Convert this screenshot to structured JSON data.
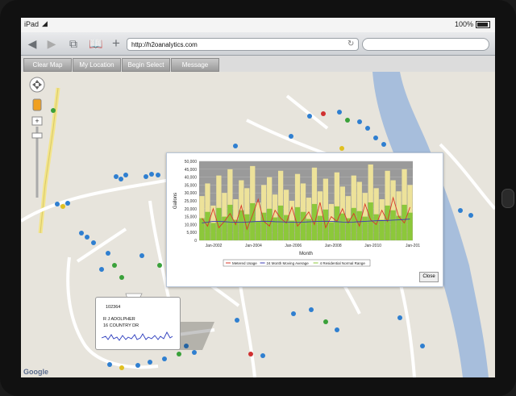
{
  "device": {
    "carrier": "iPad",
    "battery": "100%"
  },
  "browser": {
    "url": "http://h2oanalytics.com"
  },
  "app_buttons": [
    "Clear Map",
    "My Location",
    "Begin Select",
    "Message"
  ],
  "map": {
    "attribution": "Google"
  },
  "info_bubble": {
    "account_id": "102364",
    "owner": "R J ADOLPHER",
    "address": "16  COUNTRY DR"
  },
  "popup": {
    "close_label": "Close"
  },
  "colors": {
    "metered": "#d9372a",
    "moving_avg": "#3b3bb3",
    "normal_range_low": "#8cc83a",
    "normal_range_high": "#ede29a",
    "plot_bg": "#9a9a9a"
  },
  "chart_data": {
    "type": "area",
    "xlabel": "Month",
    "ylabel": "Gallons",
    "ylim": [
      0,
      50000
    ],
    "yticks": [
      "50,000",
      "45,000",
      "40,000",
      "35,000",
      "30,000",
      "25,000",
      "20,000",
      "15,000",
      "10,000",
      "5,000",
      "0"
    ],
    "xticks": [
      "Jan-2002",
      "Jan-2004",
      "Jan-2006",
      "Jan-2008",
      "Jan-2010",
      "Jan-201"
    ],
    "x_range": [
      2001.0,
      2012.1
    ],
    "series": [
      {
        "name": "Metered Usage",
        "values": [
          14000,
          9000,
          20000,
          8000,
          12000,
          17000,
          10000,
          22000,
          7000,
          16000,
          26000,
          12000,
          9000,
          19000,
          14000,
          11000,
          21000,
          9000,
          13000,
          18000,
          10000,
          24000,
          8000,
          15000,
          12000,
          20000,
          11000,
          17000,
          9000,
          23000,
          13000,
          10000,
          19000,
          12000,
          27000,
          15000,
          11000,
          21000
        ]
      },
      {
        "name": "24 Month Moving Average",
        "values": [
          11000,
          11500,
          12000,
          12000,
          11800,
          11600,
          11500,
          11400,
          11600,
          11800,
          12000,
          12100,
          12000,
          11800,
          11700,
          11600,
          11500,
          11400,
          11500,
          11700,
          11900,
          12000,
          12100,
          12000,
          11800,
          11600,
          11500,
          11600,
          11800,
          12000,
          12200,
          12400,
          12500,
          12600,
          12800,
          13000,
          13200,
          13500
        ]
      },
      {
        "name": "4 Residential Normal Range",
        "values": [
          28000,
          36000,
          22000,
          41000,
          30000,
          45000,
          26000,
          38000,
          33000,
          47000,
          24000,
          35000,
          40000,
          29000,
          44000,
          32000,
          25000,
          42000,
          36000,
          27000,
          46000,
          31000,
          39000,
          23000,
          43000,
          34000,
          28000,
          41000,
          37000,
          30000,
          48000,
          33000,
          26000,
          44000,
          38000,
          31000,
          45000,
          35000
        ]
      }
    ],
    "legend_placement": "bottom"
  }
}
